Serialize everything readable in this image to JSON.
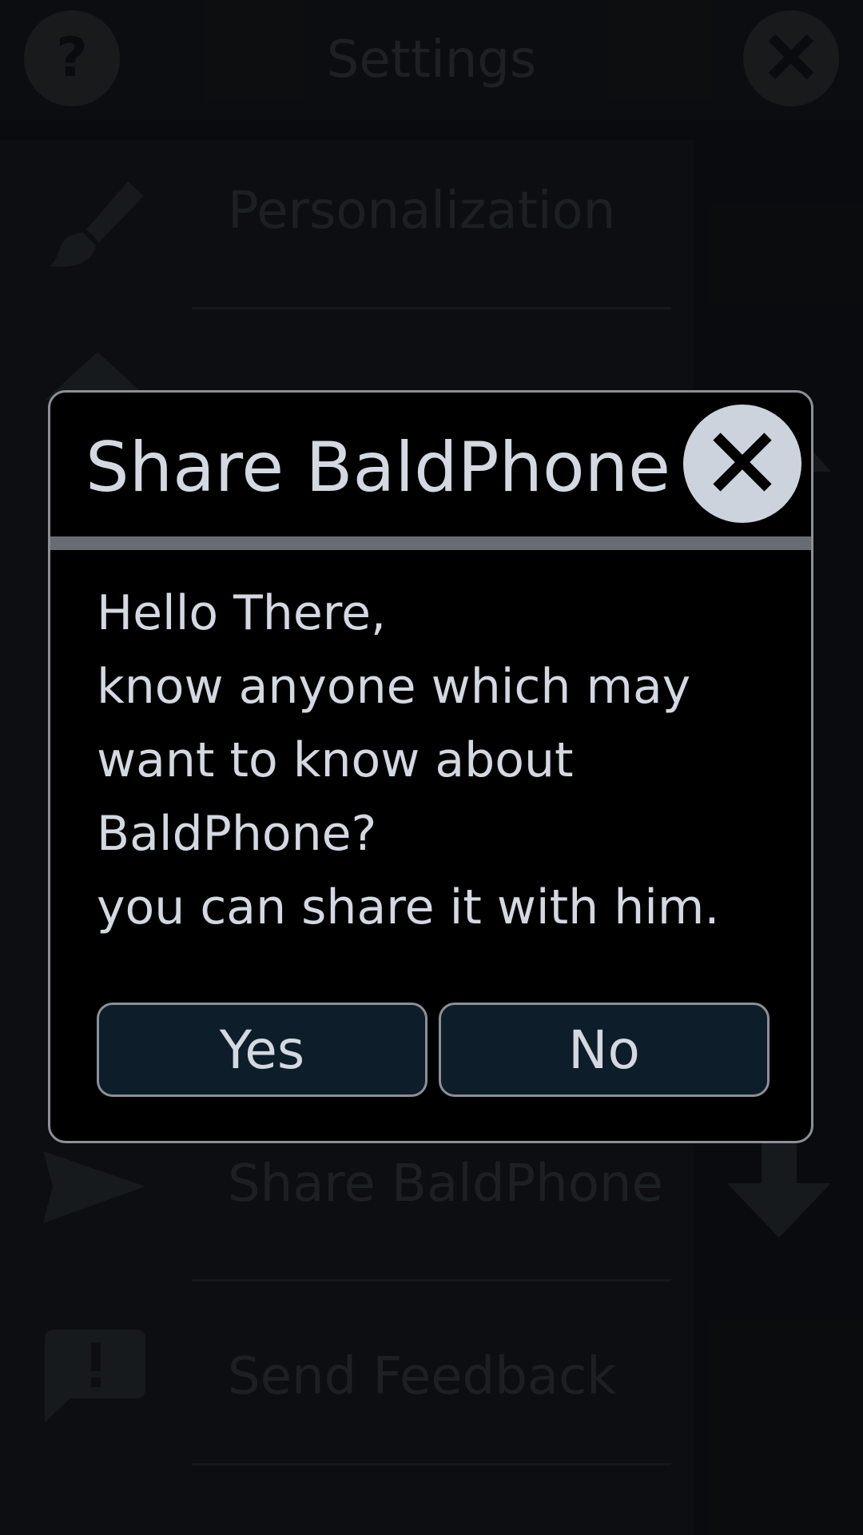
{
  "header": {
    "title": "Settings",
    "help_icon": "help-icon",
    "close_icon": "close-icon"
  },
  "settings_list": {
    "items": [
      {
        "label": "Personalization",
        "icon": "brush-icon"
      },
      {
        "label": "",
        "icon": "arrow-up-icon"
      },
      {
        "label": "",
        "icon": ""
      },
      {
        "label": "",
        "icon": ""
      },
      {
        "label": "Share BaldPhone",
        "icon": "send-icon"
      },
      {
        "label": "Send Feedback",
        "icon": "feedback-icon"
      }
    ],
    "scroll_up_icon": "arrow-up-icon",
    "scroll_down_icon": "arrow-down-icon"
  },
  "dialog": {
    "title": "Share BaldPhone",
    "close_icon": "close-icon",
    "message_lines": [
      "Hello There,",
      "know anyone which may",
      "want to know about",
      "BaldPhone?",
      "you can share it with him."
    ],
    "yes_label": "Yes",
    "no_label": "No"
  },
  "colors": {
    "dialog_background": "#000000",
    "dialog_text": "#d3d8e1",
    "button_background": "#0e1d2a",
    "rule": "#676d72",
    "close_button": "#cdd3dc"
  }
}
